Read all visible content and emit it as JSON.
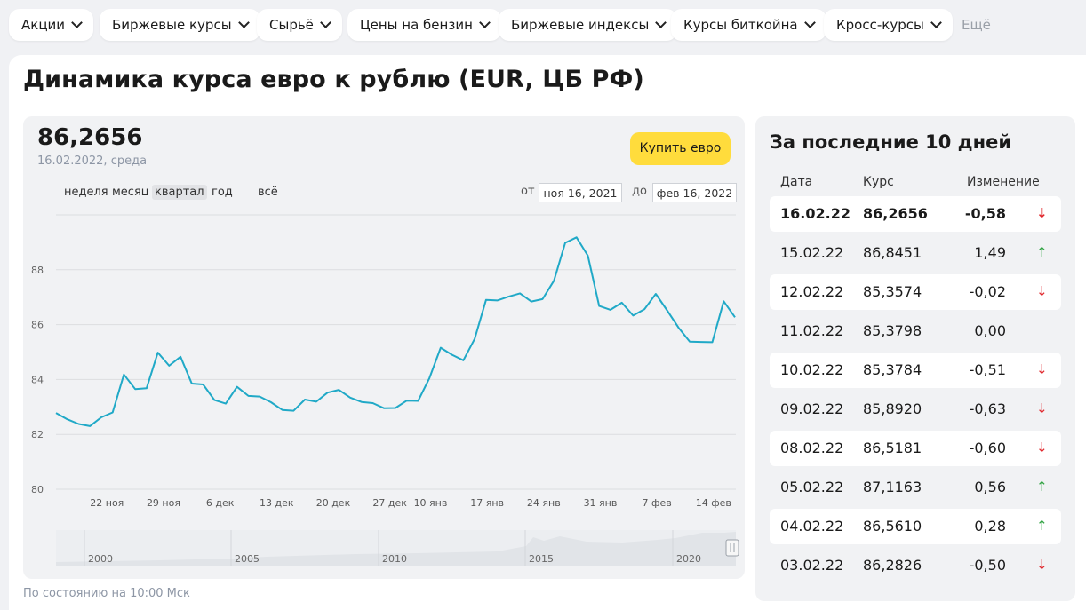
{
  "nav": {
    "items": [
      {
        "label": "Акции"
      },
      {
        "label": "Биржевые курсы"
      },
      {
        "label": "Сырьё"
      },
      {
        "label": "Цены на бензин"
      },
      {
        "label": "Биржевые индексы"
      },
      {
        "label": "Курсы биткойна"
      },
      {
        "label": "Кросс-курсы"
      }
    ],
    "more_label": "Ещё"
  },
  "page": {
    "title": "Динамика курса евро к рублю (EUR, ЦБ РФ)",
    "footnote": "По состоянию на 10:00 Мск"
  },
  "chart_panel": {
    "current_value": "86,2656",
    "current_date": "16.02.2022, среда",
    "buy_button": "Купить евро",
    "periods": [
      "неделя",
      "месяц",
      "квартал",
      "год",
      "всё"
    ],
    "active_period": "квартал",
    "from_label": "от",
    "from_value": "ноя 16, 2021",
    "to_label": "до",
    "to_value": "фев 16, 2022"
  },
  "chart_data": {
    "type": "line",
    "title": "",
    "xlabel": "",
    "ylabel": "",
    "ylim": [
      80,
      90
    ],
    "yticks": [
      80,
      82,
      84,
      86,
      88
    ],
    "grid": true,
    "line_color": "#20a9c7",
    "xtick_labels": [
      {
        "label": "22 ноя",
        "x": 4.5
      },
      {
        "label": "29 ноя",
        "x": 9.5
      },
      {
        "label": "6 дек",
        "x": 14.5
      },
      {
        "label": "13 дек",
        "x": 19.5
      },
      {
        "label": "20 дек",
        "x": 24.5
      },
      {
        "label": "27 дек",
        "x": 29.5
      },
      {
        "label": "10 янв",
        "x": 33.1
      },
      {
        "label": "17 янв",
        "x": 38.1
      },
      {
        "label": "24 янв",
        "x": 43.1
      },
      {
        "label": "31 янв",
        "x": 48.1
      },
      {
        "label": "7 фев",
        "x": 53.1
      },
      {
        "label": "14 фев",
        "x": 58.1
      }
    ],
    "series": [
      {
        "values": [
          82.78,
          82.55,
          82.38,
          82.3,
          82.62,
          82.8,
          84.18,
          83.65,
          83.68,
          84.98,
          84.5,
          84.83,
          83.85,
          83.82,
          83.25,
          83.12,
          83.73,
          83.4,
          83.38,
          83.17,
          82.89,
          82.86,
          83.27,
          83.19,
          83.52,
          83.62,
          83.34,
          83.18,
          83.14,
          82.95,
          82.96,
          83.23,
          83.22,
          84.05,
          85.16,
          84.9,
          84.7,
          85.48,
          86.9,
          86.88,
          87.02,
          87.14,
          86.84,
          86.93,
          87.6,
          88.98,
          89.18,
          88.51,
          86.68,
          86.54,
          86.8,
          86.33,
          86.56,
          87.12,
          86.52,
          85.9,
          85.38,
          85.37,
          85.36,
          86.85,
          86.27
        ]
      }
    ],
    "navigator": {
      "year_labels": [
        "2000",
        "2005",
        "2010",
        "2015",
        "2020"
      ]
    }
  },
  "table": {
    "title": "За последние 10 дней",
    "headers": {
      "date": "Дата",
      "rate": "Курс",
      "change": "Изменение"
    },
    "rows": [
      {
        "date": "16.02.22",
        "rate": "86,2656",
        "change": "-0,58",
        "dir": "down"
      },
      {
        "date": "15.02.22",
        "rate": "86,8451",
        "change": "1,49",
        "dir": "up"
      },
      {
        "date": "12.02.22",
        "rate": "85,3574",
        "change": "-0,02",
        "dir": "down"
      },
      {
        "date": "11.02.22",
        "rate": "85,3798",
        "change": "0,00",
        "dir": "none"
      },
      {
        "date": "10.02.22",
        "rate": "85,3784",
        "change": "-0,51",
        "dir": "down"
      },
      {
        "date": "09.02.22",
        "rate": "85,8920",
        "change": "-0,63",
        "dir": "down"
      },
      {
        "date": "08.02.22",
        "rate": "86,5181",
        "change": "-0,60",
        "dir": "down"
      },
      {
        "date": "05.02.22",
        "rate": "87,1163",
        "change": "0,56",
        "dir": "up"
      },
      {
        "date": "04.02.22",
        "rate": "86,5610",
        "change": "0,28",
        "dir": "up"
      },
      {
        "date": "03.02.22",
        "rate": "86,2826",
        "change": "-0,50",
        "dir": "down"
      }
    ],
    "arrow_up": "↑",
    "arrow_down": "↓"
  }
}
